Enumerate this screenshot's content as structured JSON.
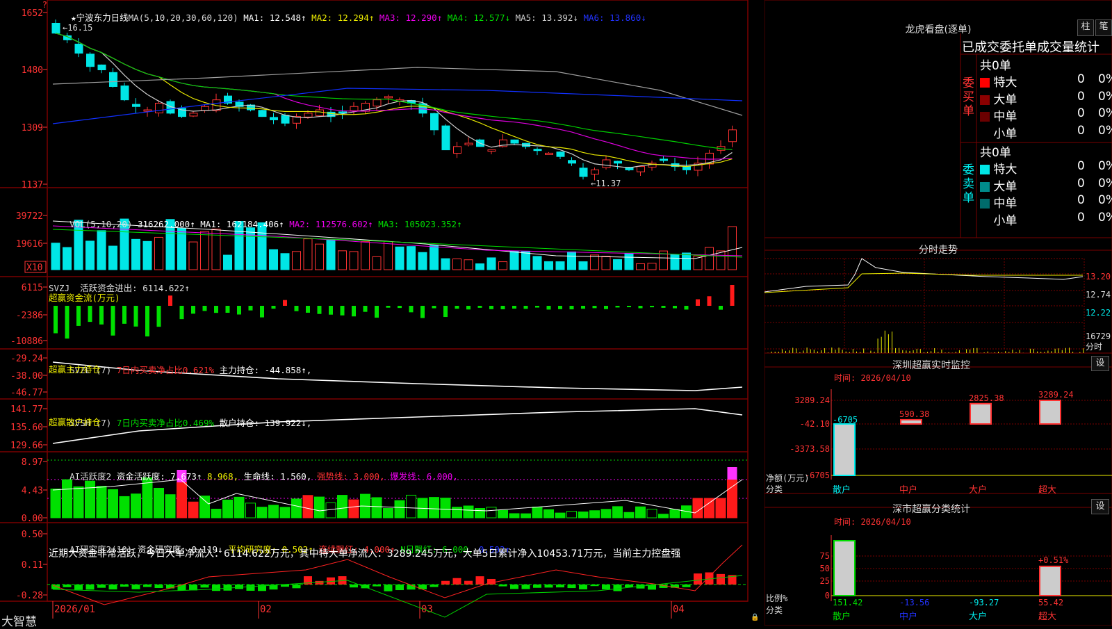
{
  "colors": {
    "up": "#ff3333",
    "down": "#00e6e6",
    "ma1": "#d0d0d0",
    "ma2": "#e8e800",
    "ma3": "#e000e0",
    "ma4": "#00d000",
    "ma5": "#a0a0a0",
    "ma6": "#1030ff",
    "vol_up": "#ff3333",
    "vol_down": "#00e6e6",
    "money_in": "#ff1a1a",
    "money_out": "#00e000",
    "ai_up": "#ff1a1a",
    "ai_down": "#00e000",
    "ai_peak": "#ff33ff",
    "grid": "#7a0000"
  },
  "chart_header": {
    "title": "★宁波东力日线",
    "ma_label": "MA(5,10,20,30,60,120)",
    "ma1": "MA1: 12.548↑",
    "ma2": "MA2: 12.294↑",
    "ma3": "MA3: 12.290↑",
    "ma4": "MA4: 12.577↓",
    "ma5": "MA5: 13.392↓",
    "ma6": "MA6: 13.860↓"
  },
  "price_axis": [
    "1652",
    "1480",
    "1309",
    "1137"
  ],
  "price_annotations": {
    "high": "16.15",
    "low": "11.37"
  },
  "vol_header": {
    "label": "VOL(5,10,20)",
    "value": "316262.000↑",
    "ma1": "MA1: 162184.406↑",
    "ma2": "MA2: 112576.602↑",
    "ma3": "MA3: 105023.352↑"
  },
  "vol_axis": [
    "39722",
    "19616",
    "X10"
  ],
  "svzj": {
    "label": "SVZJ  活跃资金进出: 6114.622↑",
    "sub": "超赢资金流(万元)",
    "axis": [
      "6115",
      "-2386",
      "-10886"
    ]
  },
  "svzl": {
    "label": "SVZL (7)",
    "ratio": "7日内买卖净占比0.621%",
    "hold": "主力持仓: -44.858↑,",
    "sub": "超赢主力持仓",
    "axis": [
      "-29.24",
      "-38.00",
      "-46.77"
    ]
  },
  "svsh": {
    "label": "SVSH (7)",
    "ratio": "7日内买卖净占比0.469%",
    "hold": "散户持仓: 139.922↓,",
    "sub": "超赢散户持仓",
    "axis": [
      "141.77",
      "135.60",
      "129.66"
    ]
  },
  "ai1": {
    "label": "AI活跃度2",
    "active": "资金活跃度: 7.673↑",
    "v2": "8.968,",
    "life": "生命线: 1.560,",
    "strong": "强势线: 3.000,",
    "burst": "爆发线: 6.000,",
    "axis": [
      "8.97",
      "4.43",
      "0.00"
    ]
  },
  "ai2": {
    "label": "AI研究度2(10)",
    "research": "资金研究度: 0.119↓",
    "avg": "平均研究度: 0.502↑",
    "lianxu": "连续飘红: 4.000↑",
    "nday": "N日飘红: 6.000,",
    "nval": "0.502↑",
    "summary": "近期大资金非常活跃，今日大单净流入：6114.622万元，其中特大单净流入：3289.245万元，大单5日累计净入10453.71万元，当前主力控盘强",
    "axis": [
      "0.50",
      "0.11",
      "-0.28"
    ]
  },
  "date_axis": [
    "2026/01",
    "02",
    "03",
    "04"
  ],
  "brand": "大智慧",
  "right": {
    "lhb_title": "龙虎看盘(逐单)",
    "btn_zhu": "柱",
    "btn_bi": "笔",
    "trade_header": "已成交委托单成交量统计",
    "buy": {
      "side": "委买单",
      "total": "共0单",
      "rows": [
        {
          "name": "特大",
          "n": "0",
          "p": "0%",
          "color": "#ff0000"
        },
        {
          "name": "大单",
          "n": "0",
          "p": "0%",
          "color": "#8b0000"
        },
        {
          "name": "中单",
          "n": "0",
          "p": "0%",
          "color": "#6b0000"
        },
        {
          "name": "小单",
          "n": "0",
          "p": "0%",
          "color": ""
        }
      ]
    },
    "sell": {
      "side": "委卖单",
      "total": "共0单",
      "rows": [
        {
          "name": "特大",
          "n": "0",
          "p": "0%",
          "color": "#00e6e6"
        },
        {
          "name": "大单",
          "n": "0",
          "p": "0%",
          "color": "#008b8b"
        },
        {
          "name": "中单",
          "n": "0",
          "p": "0%",
          "color": "#006b6b"
        },
        {
          "name": "小单",
          "n": "0",
          "p": "0%",
          "color": ""
        }
      ]
    },
    "fenshi_title": "分时走势",
    "fenshi_axis": [
      "13.20",
      "12.74",
      "12.22"
    ],
    "fenshi_vol": "16729",
    "fenshi_label": "分时",
    "sz_title": "深圳超赢实时监控",
    "sz_btn": "设",
    "sz_date": "时间: 2026/04/10",
    "sz_axis": [
      "3289.24",
      "-42.10",
      "-3373.58",
      "-6705"
    ],
    "sz_ylabel": "净额(万元)",
    "sz_xlabel": "分类",
    "sz_bars": [
      {
        "cat": "散户",
        "value": -6705,
        "label": "-6705"
      },
      {
        "cat": "中户",
        "value": 590.38,
        "label": "590.38"
      },
      {
        "cat": "大户",
        "value": 2825.38,
        "label": "2825.38"
      },
      {
        "cat": "超大",
        "value": 3289.24,
        "label": "3289.24"
      }
    ],
    "sc_title": "深市超赢分类统计",
    "sc_btn": "设",
    "sc_date": "时间: 2026/04/10",
    "sc_axis": [
      "75",
      "50",
      "25",
      "0"
    ],
    "sc_ylabel": "比例%",
    "sc_xlabel": "分类",
    "sc_bars": [
      {
        "cat": "散户",
        "value": 151.42,
        "label": "151.42"
      },
      {
        "cat": "中户",
        "value": -13.56,
        "label": "-13.56"
      },
      {
        "cat": "大户",
        "value": -93.27,
        "label": "-93.27"
      },
      {
        "cat": "超大",
        "value": 55.42,
        "label": "55.42",
        "top": "+0.51%"
      }
    ]
  }
}
